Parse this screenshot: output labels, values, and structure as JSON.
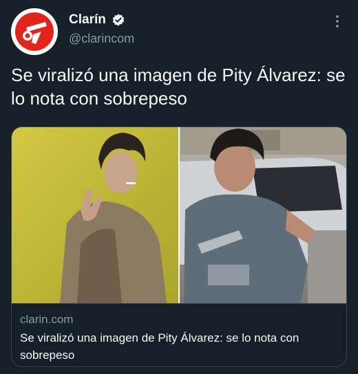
{
  "author": {
    "display_name": "Clarín",
    "handle": "@clarincom",
    "verified": true,
    "avatar_icon": "clarin-logo-icon"
  },
  "tweet": {
    "text": "Se viralizó una imagen de Pity Álvarez: se lo nota con sobrepeso"
  },
  "card": {
    "domain": "clarin.com",
    "title": "Se viralizó una imagen de Pity Álvarez: se lo nota con sobrepeso",
    "image_icon": "photo-collage"
  },
  "menu_icon": "more-vertical-icon",
  "colors": {
    "background": "#15202b",
    "text": "#f7f9f9",
    "secondary_text": "#8b98a5",
    "border": "#38444d",
    "brand_red": "#e1251b",
    "verified_badge": "#f7f9f9"
  }
}
